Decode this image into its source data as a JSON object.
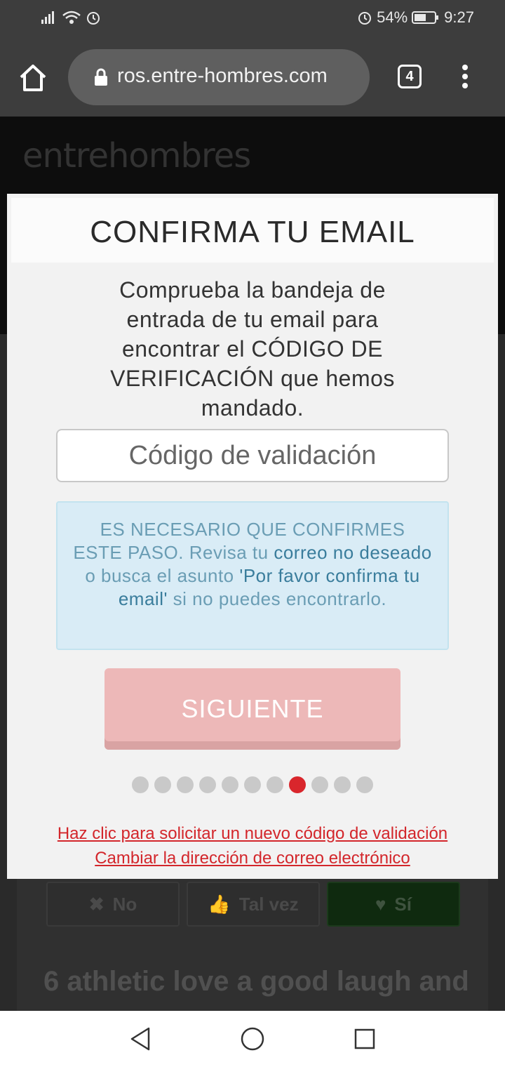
{
  "status_bar": {
    "battery": "54%",
    "time": "9:27"
  },
  "browser": {
    "url": "ros.entre-hombres.com",
    "tab_count": "4"
  },
  "site": {
    "logo": "entrehombres"
  },
  "background": {
    "buttons": {
      "no": "No",
      "maybe": "Tal vez",
      "yes": "Sí"
    },
    "text": "6 athletic love a good laugh and"
  },
  "modal": {
    "title": "CONFIRMA TU EMAIL",
    "description": "Comprueba la bandeja de entrada de tu email para encontrar el CÓDIGO DE VERIFICACIÓN que hemos mandado.",
    "input_placeholder": "Código de validación",
    "info": {
      "part1": "ES NECESARIO QUE CONFIRMES ESTE PASO. Revisa tu ",
      "highlight1": "correo no deseado",
      "part2": " o busca el asunto ",
      "highlight2": "'Por favor confirma tu email'",
      "part3": " si no puedes encontrarlo."
    },
    "next_button": "SIGUIENTE",
    "progress": {
      "total": 11,
      "current": 8
    },
    "link_new_code": "Haz clic para solicitar un nuevo código de validación",
    "link_change_email": "Cambiar la dirección de correo electrónico"
  },
  "colors": {
    "accent_red": "#d3262b",
    "button_disabled": "#edb8b8",
    "info_bg": "#d9ecf6"
  }
}
